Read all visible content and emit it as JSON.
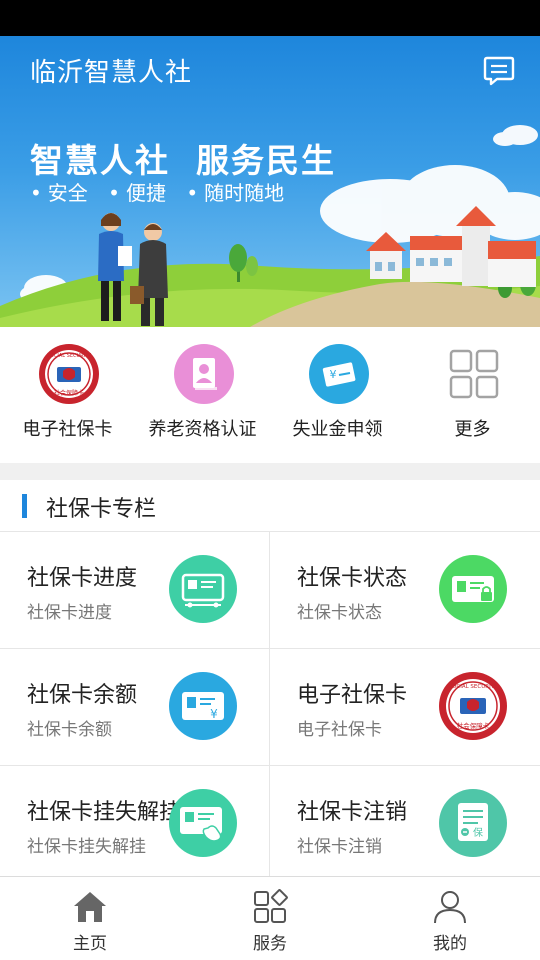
{
  "header": {
    "title": "临沂智慧人社",
    "slogan_left": "智慧人社",
    "slogan_right": "服务民生",
    "tags": [
      "安全",
      "便捷",
      "随时随地"
    ]
  },
  "quick_actions": [
    {
      "label": "电子社保卡",
      "icon": "social-security-card-seal-icon"
    },
    {
      "label": "养老资格认证",
      "icon": "id-photo-icon"
    },
    {
      "label": "失业金申领",
      "icon": "yuan-card-icon"
    },
    {
      "label": "更多",
      "icon": "grid-more-icon"
    }
  ],
  "section": {
    "title": "社保卡专栏",
    "items": [
      {
        "title": "社保卡进度",
        "subtitle": "社保卡进度",
        "icon": "card-progress-icon",
        "color": "#3ecfa5"
      },
      {
        "title": "社保卡状态",
        "subtitle": "社保卡状态",
        "icon": "card-lock-icon",
        "color": "#4cd964"
      },
      {
        "title": "社保卡余额",
        "subtitle": "社保卡余额",
        "icon": "card-yuan-icon",
        "color": "#2aa8e0"
      },
      {
        "title": "电子社保卡",
        "subtitle": "电子社保卡",
        "icon": "social-security-card-seal-icon",
        "color": "#c8242d"
      },
      {
        "title": "社保卡挂失解挂",
        "subtitle": "社保卡挂失解挂",
        "icon": "card-phone-icon",
        "color": "#3ecfa5"
      },
      {
        "title": "社保卡注销",
        "subtitle": "社保卡注销",
        "icon": "document-cancel-icon",
        "color": "#4fc6a8"
      }
    ]
  },
  "tabbar": [
    {
      "label": "主页",
      "icon": "home-icon"
    },
    {
      "label": "服务",
      "icon": "services-grid-icon"
    },
    {
      "label": "我的",
      "icon": "profile-icon"
    }
  ],
  "colors": {
    "brand_blue": "#1e86dc",
    "seal_red": "#c8242d",
    "teal": "#3ecfa5"
  }
}
